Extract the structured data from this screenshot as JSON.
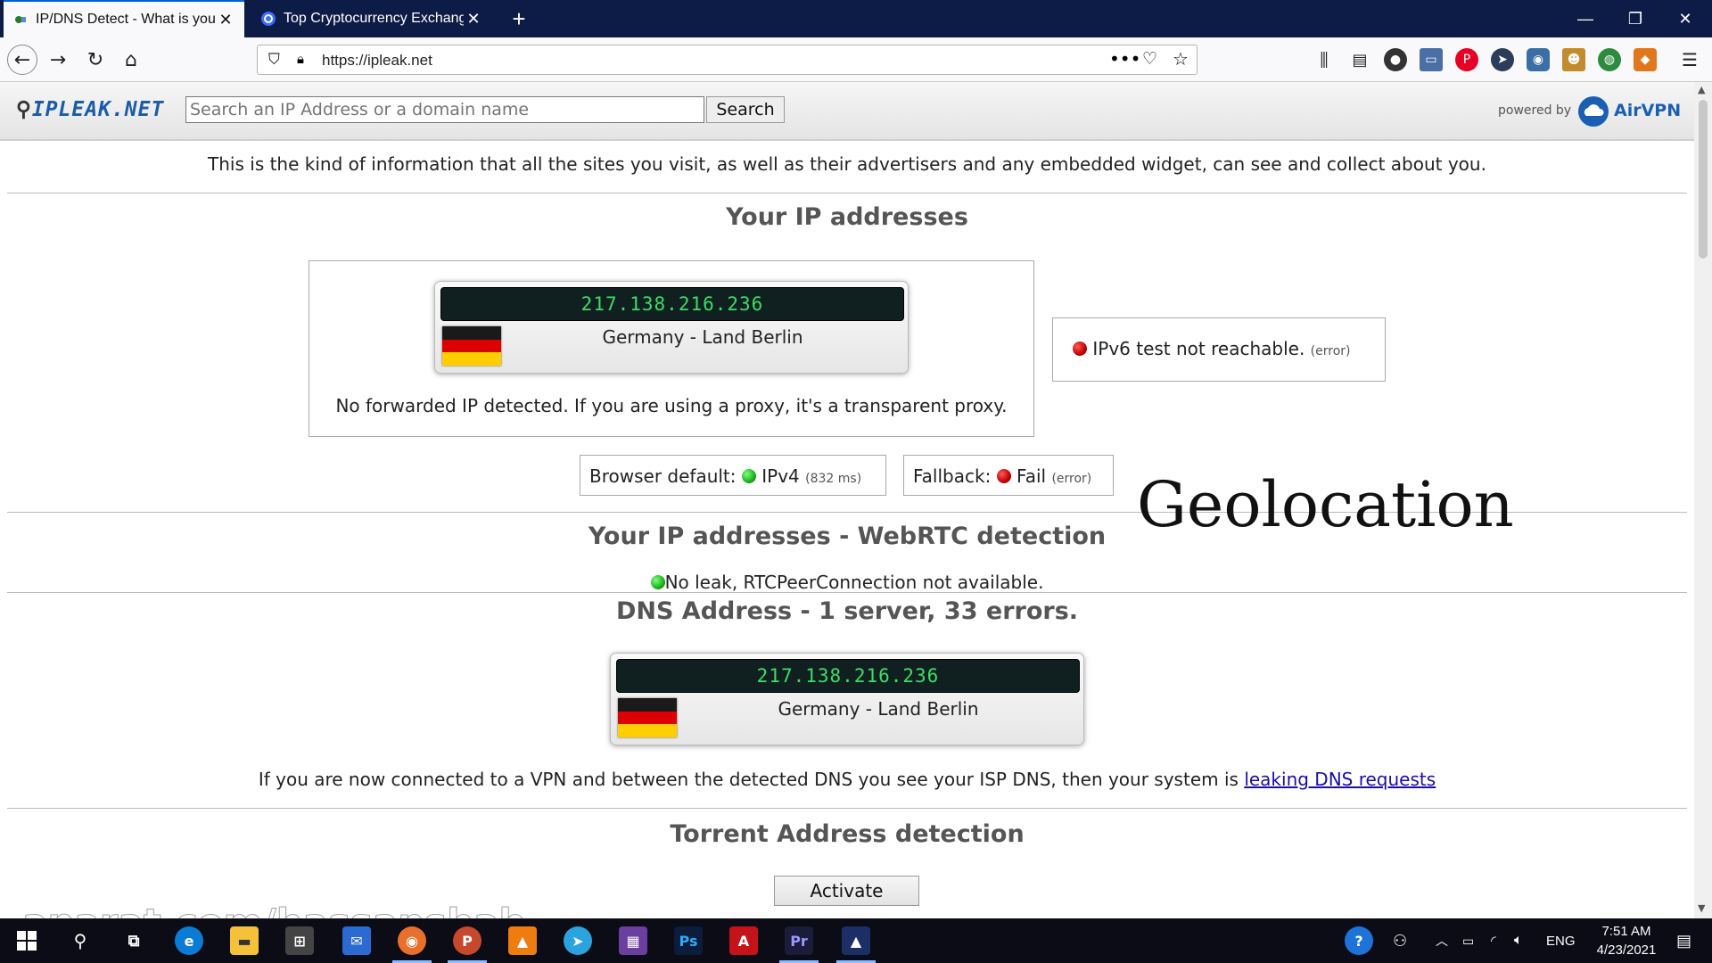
{
  "browser": {
    "tabs": [
      {
        "title": "IP/DNS Detect - What is your IP",
        "active": true
      },
      {
        "title": "Top Cryptocurrency Exchanges",
        "active": false
      }
    ],
    "new_tab": "+",
    "url": "https://ipleak.net",
    "window_controls": {
      "minimize": "—",
      "restore": "❐",
      "close": "✕"
    }
  },
  "site": {
    "logo": "IPLEAK.NET",
    "search_placeholder": "Search an IP Address or a domain name",
    "search_button": "Search",
    "powered_by": "powered by",
    "brand": "AirVPN"
  },
  "intro": "This is the kind of information that all the sites you visit, as well as their advertisers and any embedded widget, can see and collect about you.",
  "ip_section": {
    "title": "Your IP addresses",
    "ip": "217.138.216.236",
    "location": "Germany - Land Berlin",
    "forward_note": "No forwarded IP detected. If you are using a proxy, it's a transparent proxy.",
    "ipv6": {
      "text": "IPv6 test not reachable.",
      "status": "(error)"
    },
    "browser_default": {
      "label": "Browser default:",
      "value": "IPv4",
      "detail": "(832 ms)"
    },
    "fallback": {
      "label": "Fallback:",
      "value": "Fail",
      "detail": "(error)"
    }
  },
  "overlay_text": "Geolocation",
  "webrtc": {
    "title": "Your IP addresses - WebRTC detection",
    "status": "No leak, RTCPeerConnection not available."
  },
  "dns": {
    "title": "DNS Address - 1 server, 33 errors.",
    "ip": "217.138.216.236",
    "location": "Germany - Land Berlin",
    "note": "If you are now connected to a VPN and between the detected DNS you see your ISP DNS, then your system is",
    "link": "leaking DNS requests"
  },
  "torrent": {
    "title": "Torrent Address detection",
    "button": "Activate"
  },
  "watermark": "aparat.com/hassanshab",
  "taskbar": {
    "lang": "ENG",
    "time": "7:51 AM",
    "date": "4/23/2021"
  },
  "colors": {
    "tabstrip": "#0d1b47",
    "ip_text": "#3ddc66",
    "heading": "#555555",
    "link": "#1a0dab"
  }
}
